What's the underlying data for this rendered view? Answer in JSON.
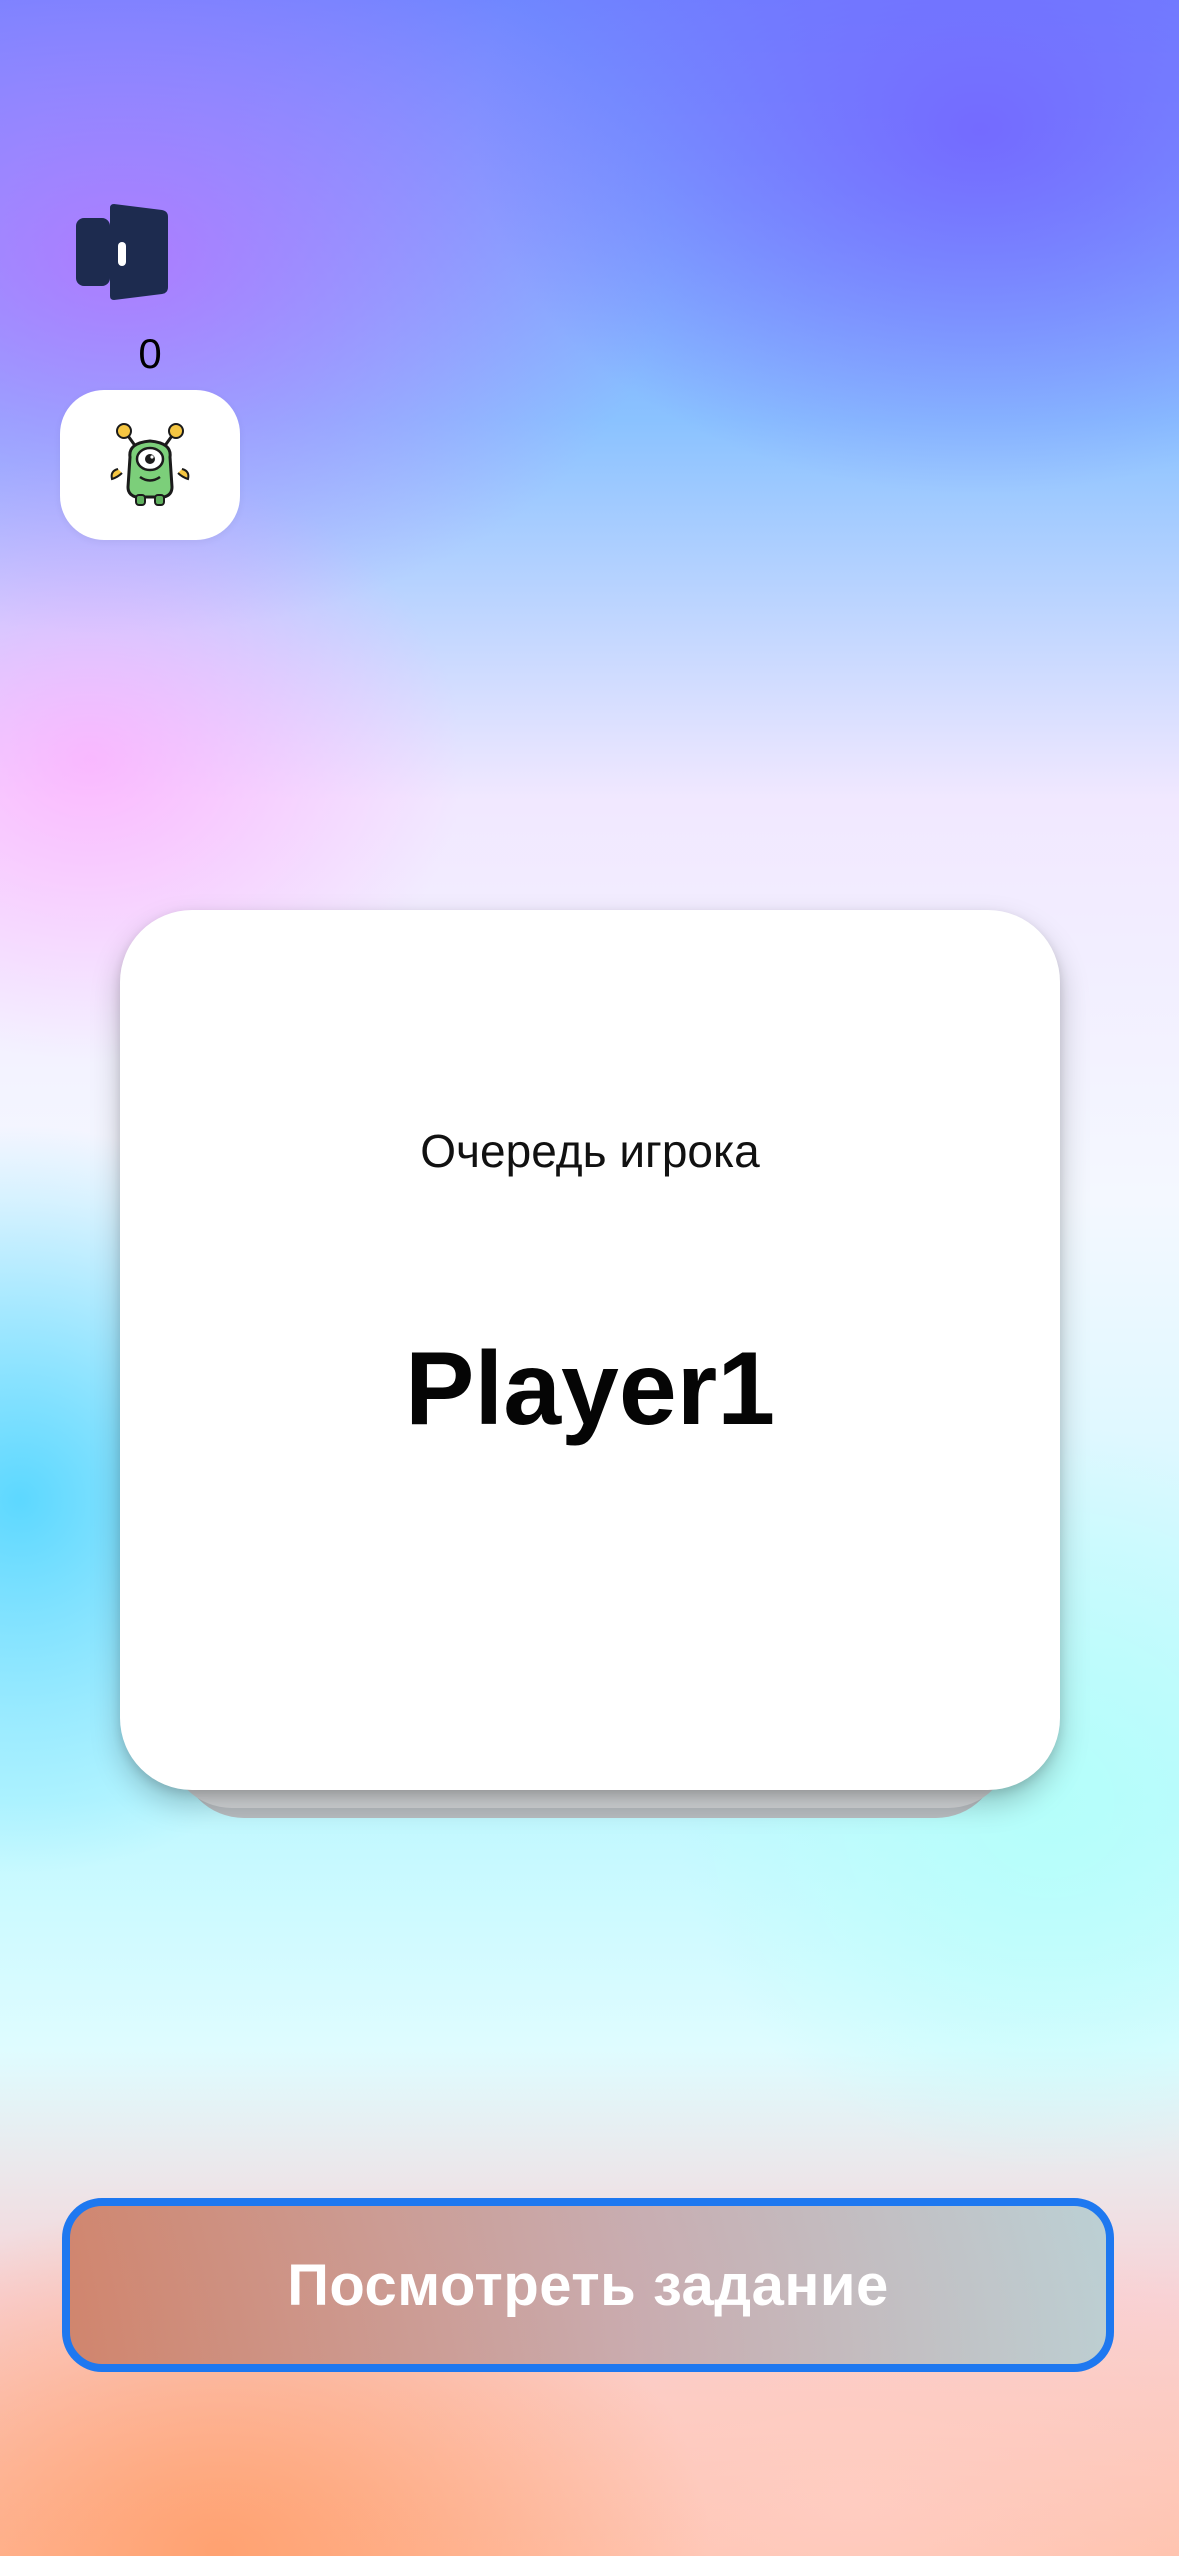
{
  "header": {
    "exit_icon": "door-exit-icon",
    "score": "0",
    "avatar_icon": "green-monster-icon"
  },
  "card": {
    "turn_label": "Очередь игрока",
    "player_name": "Player1"
  },
  "actions": {
    "view_task_label": "Посмотреть задание"
  },
  "colors": {
    "primary_dark": "#1d2b4f",
    "button_border": "#1e78f0",
    "card_bg": "#ffffff"
  }
}
